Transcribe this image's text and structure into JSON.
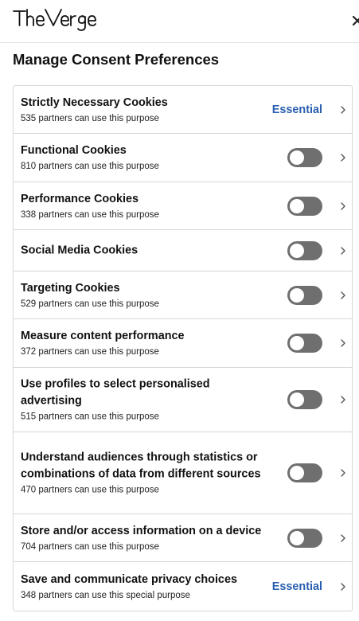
{
  "brand": {
    "logo_text": "TheVerge",
    "close_label": "×"
  },
  "heading": "Manage Consent Preferences",
  "rows": [
    {
      "title": "Strictly Necessary Cookies",
      "subtitle": "535 partners can use this purpose",
      "status": "Essential",
      "has_toggle": false,
      "toggle_on": false
    },
    {
      "title": "Functional Cookies",
      "subtitle": "810 partners can use this purpose",
      "status": "",
      "has_toggle": true,
      "toggle_on": false
    },
    {
      "title": "Performance Cookies",
      "subtitle": "338 partners can use this purpose",
      "status": "",
      "has_toggle": true,
      "toggle_on": false
    },
    {
      "title": "Social Media Cookies",
      "subtitle": "",
      "status": "",
      "has_toggle": true,
      "toggle_on": false
    },
    {
      "title": "Targeting Cookies",
      "subtitle": "529 partners can use this purpose",
      "status": "",
      "has_toggle": true,
      "toggle_on": false
    },
    {
      "title": "Measure content performance",
      "subtitle": "372 partners can use this purpose",
      "status": "",
      "has_toggle": true,
      "toggle_on": false
    },
    {
      "title": "Use profiles to select personalised advertising",
      "subtitle": "515 partners can use this purpose",
      "status": "",
      "has_toggle": true,
      "toggle_on": false
    },
    {
      "title": "Understand audiences through statistics or combinations of data from different sources",
      "subtitle": "470 partners can use this purpose",
      "status": "",
      "has_toggle": true,
      "toggle_on": false
    },
    {
      "title": "Store and/or access information on a device",
      "subtitle": "704 partners can use this purpose",
      "status": "",
      "has_toggle": true,
      "toggle_on": false
    },
    {
      "title": "Save and communicate privacy choices",
      "subtitle": "348 partners can use this special purpose",
      "status": "Essential",
      "has_toggle": false,
      "toggle_on": false
    }
  ],
  "colors": {
    "essential": "#2a5fb0",
    "toggle_off": "#6f6f6f",
    "border": "#d6d6d6"
  },
  "icons": {
    "close": "close-icon",
    "chevron": "chevron-right-icon"
  }
}
